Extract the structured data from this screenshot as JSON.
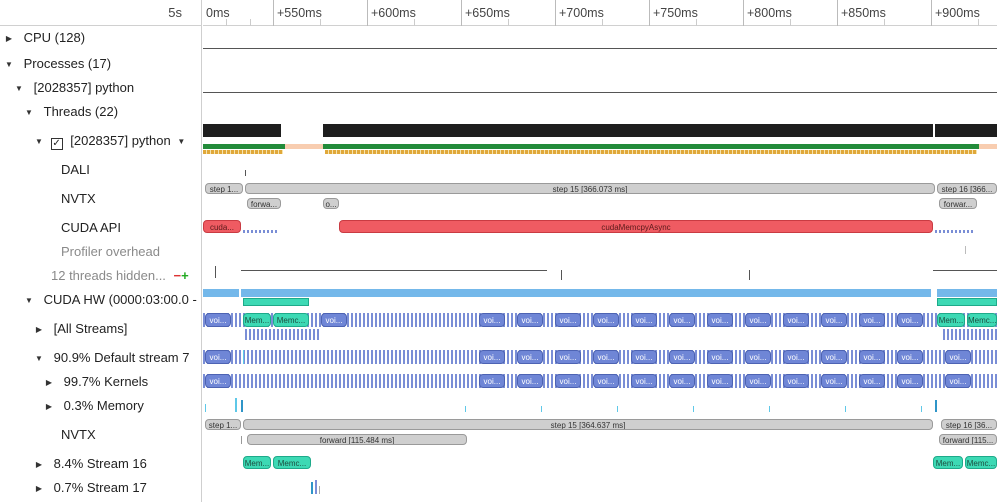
{
  "ruler": {
    "scale": "5s",
    "ticks": [
      "0ms",
      "+550ms",
      "+600ms",
      "+650ms",
      "+700ms",
      "+750ms",
      "+800ms",
      "+850ms",
      "+900ms"
    ]
  },
  "tree": {
    "cpu": "CPU (128)",
    "processes": "Processes (17)",
    "process": "[2028357] python",
    "threads": "Threads (22)",
    "thread": "[2028357] python",
    "dali": "DALI",
    "nvtx": "NVTX",
    "cuda_api": "CUDA API",
    "profiler_overhead": "Profiler overhead",
    "hidden_threads": "12 threads hidden...",
    "cuda_hw": "CUDA HW (0000:03:00.0 -",
    "all_streams": "[All Streams]",
    "default_stream": "90.9% Default stream 7",
    "kernels": "99.7% Kernels",
    "memory": "0.3% Memory",
    "hw_nvtx": "NVTX",
    "stream16": "8.4% Stream 16",
    "stream17": "0.7% Stream 17"
  },
  "bars": {
    "step1_left": "step 1...",
    "step15_cpu": "step 15 [366.073 ms]",
    "step16_cpu": "step 16 [366...",
    "forward_short": "forwa...",
    "o_short": "o...",
    "forward_right": "forwar...",
    "cuda_left": "cuda...",
    "cuda_memcpy": "cudaMemcpyAsync",
    "kernel_short": "voi...",
    "mem_short1": "Mem...",
    "mem_short2": "Memc...",
    "step1_hw": "step 1...",
    "step15_hw": "step 15 [364.637 ms]",
    "step16_hw": "step 16 [36...",
    "forward_hw": "forward [115.484 ms]",
    "forward_hw_right": "forward [115..."
  },
  "colors": {
    "kernel": "#6f86d6",
    "memcpy": "#3dd9b4",
    "cuda_api": "#ef5b62",
    "nvtx": "#cfcfcf",
    "cpu_usage": "#1e1e1e",
    "thread_state": "#228b3a"
  }
}
